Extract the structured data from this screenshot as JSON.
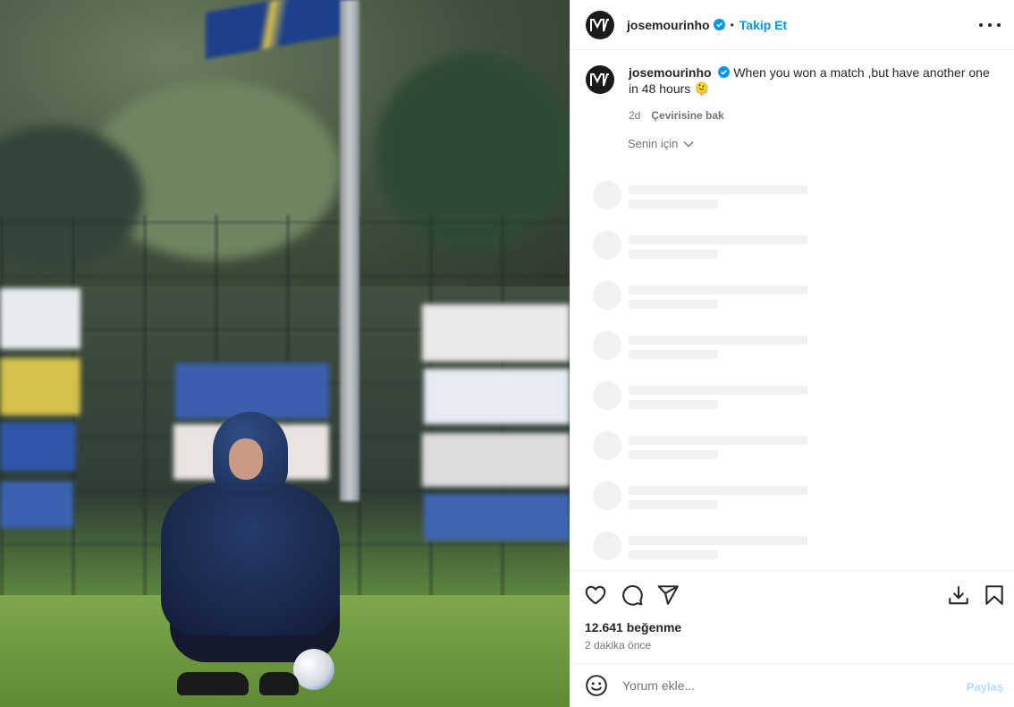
{
  "header": {
    "username": "josemourinho",
    "separator": "•",
    "follow_label": "Takip Et"
  },
  "caption": {
    "username": "josemourinho",
    "text": "When you won a match ,but have another one in 48 hours 🫠",
    "age": "2d",
    "see_translation": "Çevirisine bak"
  },
  "comments_filter": {
    "label": "Senin için"
  },
  "stats": {
    "likes": "12.641 beğenme",
    "posted": "2 dakika önce"
  },
  "comment_box": {
    "placeholder": "Yorum ekle...",
    "post_label": "Paylaş"
  },
  "icons": {
    "verified": "verified-badge-icon",
    "more": "more-options-icon",
    "like": "heart-icon",
    "comment": "comment-icon",
    "share": "send-icon",
    "download": "download-icon",
    "save": "bookmark-icon",
    "emoji": "emoji-icon",
    "chevron": "chevron-down-icon"
  },
  "colors": {
    "accent": "#0095f6",
    "verified": "#0095f6",
    "post_disabled": "#b3dbff",
    "muted": "#737373"
  }
}
